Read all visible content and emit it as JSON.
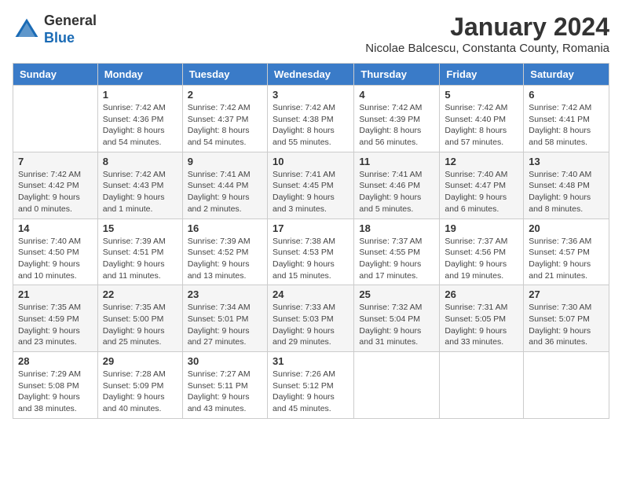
{
  "logo": {
    "general": "General",
    "blue": "Blue"
  },
  "title": "January 2024",
  "location": "Nicolae Balcescu, Constanta County, Romania",
  "weekdays": [
    "Sunday",
    "Monday",
    "Tuesday",
    "Wednesday",
    "Thursday",
    "Friday",
    "Saturday"
  ],
  "weeks": [
    [
      {
        "day": "",
        "sunrise": "",
        "sunset": "",
        "daylight": ""
      },
      {
        "day": "1",
        "sunrise": "Sunrise: 7:42 AM",
        "sunset": "Sunset: 4:36 PM",
        "daylight": "Daylight: 8 hours and 54 minutes."
      },
      {
        "day": "2",
        "sunrise": "Sunrise: 7:42 AM",
        "sunset": "Sunset: 4:37 PM",
        "daylight": "Daylight: 8 hours and 54 minutes."
      },
      {
        "day": "3",
        "sunrise": "Sunrise: 7:42 AM",
        "sunset": "Sunset: 4:38 PM",
        "daylight": "Daylight: 8 hours and 55 minutes."
      },
      {
        "day": "4",
        "sunrise": "Sunrise: 7:42 AM",
        "sunset": "Sunset: 4:39 PM",
        "daylight": "Daylight: 8 hours and 56 minutes."
      },
      {
        "day": "5",
        "sunrise": "Sunrise: 7:42 AM",
        "sunset": "Sunset: 4:40 PM",
        "daylight": "Daylight: 8 hours and 57 minutes."
      },
      {
        "day": "6",
        "sunrise": "Sunrise: 7:42 AM",
        "sunset": "Sunset: 4:41 PM",
        "daylight": "Daylight: 8 hours and 58 minutes."
      }
    ],
    [
      {
        "day": "7",
        "sunrise": "Sunrise: 7:42 AM",
        "sunset": "Sunset: 4:42 PM",
        "daylight": "Daylight: 9 hours and 0 minutes."
      },
      {
        "day": "8",
        "sunrise": "Sunrise: 7:42 AM",
        "sunset": "Sunset: 4:43 PM",
        "daylight": "Daylight: 9 hours and 1 minute."
      },
      {
        "day": "9",
        "sunrise": "Sunrise: 7:41 AM",
        "sunset": "Sunset: 4:44 PM",
        "daylight": "Daylight: 9 hours and 2 minutes."
      },
      {
        "day": "10",
        "sunrise": "Sunrise: 7:41 AM",
        "sunset": "Sunset: 4:45 PM",
        "daylight": "Daylight: 9 hours and 3 minutes."
      },
      {
        "day": "11",
        "sunrise": "Sunrise: 7:41 AM",
        "sunset": "Sunset: 4:46 PM",
        "daylight": "Daylight: 9 hours and 5 minutes."
      },
      {
        "day": "12",
        "sunrise": "Sunrise: 7:40 AM",
        "sunset": "Sunset: 4:47 PM",
        "daylight": "Daylight: 9 hours and 6 minutes."
      },
      {
        "day": "13",
        "sunrise": "Sunrise: 7:40 AM",
        "sunset": "Sunset: 4:48 PM",
        "daylight": "Daylight: 9 hours and 8 minutes."
      }
    ],
    [
      {
        "day": "14",
        "sunrise": "Sunrise: 7:40 AM",
        "sunset": "Sunset: 4:50 PM",
        "daylight": "Daylight: 9 hours and 10 minutes."
      },
      {
        "day": "15",
        "sunrise": "Sunrise: 7:39 AM",
        "sunset": "Sunset: 4:51 PM",
        "daylight": "Daylight: 9 hours and 11 minutes."
      },
      {
        "day": "16",
        "sunrise": "Sunrise: 7:39 AM",
        "sunset": "Sunset: 4:52 PM",
        "daylight": "Daylight: 9 hours and 13 minutes."
      },
      {
        "day": "17",
        "sunrise": "Sunrise: 7:38 AM",
        "sunset": "Sunset: 4:53 PM",
        "daylight": "Daylight: 9 hours and 15 minutes."
      },
      {
        "day": "18",
        "sunrise": "Sunrise: 7:37 AM",
        "sunset": "Sunset: 4:55 PM",
        "daylight": "Daylight: 9 hours and 17 minutes."
      },
      {
        "day": "19",
        "sunrise": "Sunrise: 7:37 AM",
        "sunset": "Sunset: 4:56 PM",
        "daylight": "Daylight: 9 hours and 19 minutes."
      },
      {
        "day": "20",
        "sunrise": "Sunrise: 7:36 AM",
        "sunset": "Sunset: 4:57 PM",
        "daylight": "Daylight: 9 hours and 21 minutes."
      }
    ],
    [
      {
        "day": "21",
        "sunrise": "Sunrise: 7:35 AM",
        "sunset": "Sunset: 4:59 PM",
        "daylight": "Daylight: 9 hours and 23 minutes."
      },
      {
        "day": "22",
        "sunrise": "Sunrise: 7:35 AM",
        "sunset": "Sunset: 5:00 PM",
        "daylight": "Daylight: 9 hours and 25 minutes."
      },
      {
        "day": "23",
        "sunrise": "Sunrise: 7:34 AM",
        "sunset": "Sunset: 5:01 PM",
        "daylight": "Daylight: 9 hours and 27 minutes."
      },
      {
        "day": "24",
        "sunrise": "Sunrise: 7:33 AM",
        "sunset": "Sunset: 5:03 PM",
        "daylight": "Daylight: 9 hours and 29 minutes."
      },
      {
        "day": "25",
        "sunrise": "Sunrise: 7:32 AM",
        "sunset": "Sunset: 5:04 PM",
        "daylight": "Daylight: 9 hours and 31 minutes."
      },
      {
        "day": "26",
        "sunrise": "Sunrise: 7:31 AM",
        "sunset": "Sunset: 5:05 PM",
        "daylight": "Daylight: 9 hours and 33 minutes."
      },
      {
        "day": "27",
        "sunrise": "Sunrise: 7:30 AM",
        "sunset": "Sunset: 5:07 PM",
        "daylight": "Daylight: 9 hours and 36 minutes."
      }
    ],
    [
      {
        "day": "28",
        "sunrise": "Sunrise: 7:29 AM",
        "sunset": "Sunset: 5:08 PM",
        "daylight": "Daylight: 9 hours and 38 minutes."
      },
      {
        "day": "29",
        "sunrise": "Sunrise: 7:28 AM",
        "sunset": "Sunset: 5:09 PM",
        "daylight": "Daylight: 9 hours and 40 minutes."
      },
      {
        "day": "30",
        "sunrise": "Sunrise: 7:27 AM",
        "sunset": "Sunset: 5:11 PM",
        "daylight": "Daylight: 9 hours and 43 minutes."
      },
      {
        "day": "31",
        "sunrise": "Sunrise: 7:26 AM",
        "sunset": "Sunset: 5:12 PM",
        "daylight": "Daylight: 9 hours and 45 minutes."
      },
      {
        "day": "",
        "sunrise": "",
        "sunset": "",
        "daylight": ""
      },
      {
        "day": "",
        "sunrise": "",
        "sunset": "",
        "daylight": ""
      },
      {
        "day": "",
        "sunrise": "",
        "sunset": "",
        "daylight": ""
      }
    ]
  ]
}
